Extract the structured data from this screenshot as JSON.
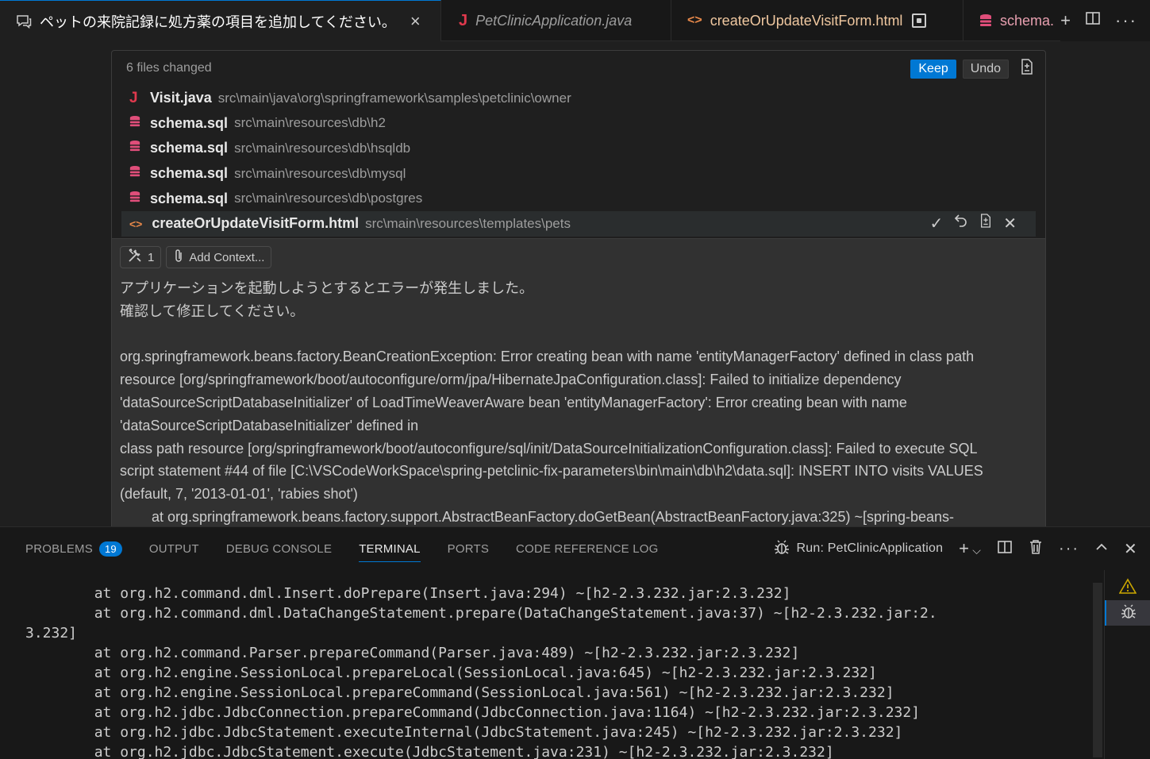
{
  "tabs": [
    {
      "label": "ペットの来院記録に処方薬の項目を追加してください。",
      "icon": "chat-icon",
      "active": true
    },
    {
      "label": "PetClinicApplication.java",
      "icon": "java-icon"
    },
    {
      "label": "createOrUpdateVisitForm.html",
      "icon": "html-icon"
    },
    {
      "label": "schema.",
      "icon": "database-icon"
    }
  ],
  "changes": {
    "summary": "6 files changed",
    "keep_label": "Keep",
    "undo_label": "Undo",
    "files": [
      {
        "name": "Visit.java",
        "path": "src\\main\\java\\org\\springframework\\samples\\petclinic\\owner",
        "icon": "java-icon"
      },
      {
        "name": "schema.sql",
        "path": "src\\main\\resources\\db\\h2",
        "icon": "database-icon"
      },
      {
        "name": "schema.sql",
        "path": "src\\main\\resources\\db\\hsqldb",
        "icon": "database-icon"
      },
      {
        "name": "schema.sql",
        "path": "src\\main\\resources\\db\\mysql",
        "icon": "database-icon"
      },
      {
        "name": "schema.sql",
        "path": "src\\main\\resources\\db\\postgres",
        "icon": "database-icon"
      },
      {
        "name": "createOrUpdateVisitForm.html",
        "path": "src\\main\\resources\\templates\\pets",
        "icon": "html-icon",
        "selected": true
      }
    ]
  },
  "chat": {
    "tools_count": "1",
    "add_context_label": "Add Context...",
    "message_lines": [
      "アプリケーションを起動しようとするとエラーが発生しました。",
      "確認して修正してください。",
      "",
      "org.springframework.beans.factory.BeanCreationException: Error creating bean with name 'entityManagerFactory' defined in class path",
      "resource [org/springframework/boot/autoconfigure/orm/jpa/HibernateJpaConfiguration.class]: Failed to initialize dependency",
      "'dataSourceScriptDatabaseInitializer' of LoadTimeWeaverAware bean 'entityManagerFactory': Error creating bean with name",
      "'dataSourceScriptDatabaseInitializer' defined in",
      "class path resource [org/springframework/boot/autoconfigure/sql/init/DataSourceInitializationConfiguration.class]: Failed to execute SQL",
      "script statement #44 of file [C:\\VSCodeWorkSpace\\spring-petclinic-fix-parameters\\bin\\main\\db\\h2\\data.sql]: INSERT INTO visits VALUES",
      "(default, 7, '2013-01-01', 'rabies shot')",
      "        at org.springframework.beans.factory.support.AbstractBeanFactory.doGetBean(AbstractBeanFactory.java:325) ~[spring-beans-"
    ]
  },
  "panel": {
    "tabs": [
      {
        "label": "PROBLEMS",
        "badge": "19"
      },
      {
        "label": "OUTPUT"
      },
      {
        "label": "DEBUG CONSOLE"
      },
      {
        "label": "TERMINAL",
        "active": true
      },
      {
        "label": "PORTS"
      },
      {
        "label": "CODE REFERENCE LOG"
      }
    ],
    "run_label": "Run: PetClinicApplication",
    "terminal_lines": [
      "        at org.h2.command.dml.Insert.doPrepare(Insert.java:294) ~[h2-2.3.232.jar:2.3.232]",
      "        at org.h2.command.dml.DataChangeStatement.prepare(DataChangeStatement.java:37) ~[h2-2.3.232.jar:2.",
      "3.232]",
      "        at org.h2.command.Parser.prepareCommand(Parser.java:489) ~[h2-2.3.232.jar:2.3.232]",
      "        at org.h2.engine.SessionLocal.prepareLocal(SessionLocal.java:645) ~[h2-2.3.232.jar:2.3.232]",
      "        at org.h2.engine.SessionLocal.prepareCommand(SessionLocal.java:561) ~[h2-2.3.232.jar:2.3.232]",
      "        at org.h2.jdbc.JdbcConnection.prepareCommand(JdbcConnection.java:1164) ~[h2-2.3.232.jar:2.3.232]",
      "        at org.h2.jdbc.JdbcStatement.executeInternal(JdbcStatement.java:245) ~[h2-2.3.232.jar:2.3.232]",
      "        at org.h2.jdbc.JdbcStatement.execute(JdbcStatement.java:231) ~[h2-2.3.232.jar:2.3.232]"
    ]
  },
  "colors": {
    "accent": "#0078d4",
    "java": "#e0394d",
    "database": "#e04e7a",
    "html": "#e8894a",
    "warning": "#cca700"
  }
}
